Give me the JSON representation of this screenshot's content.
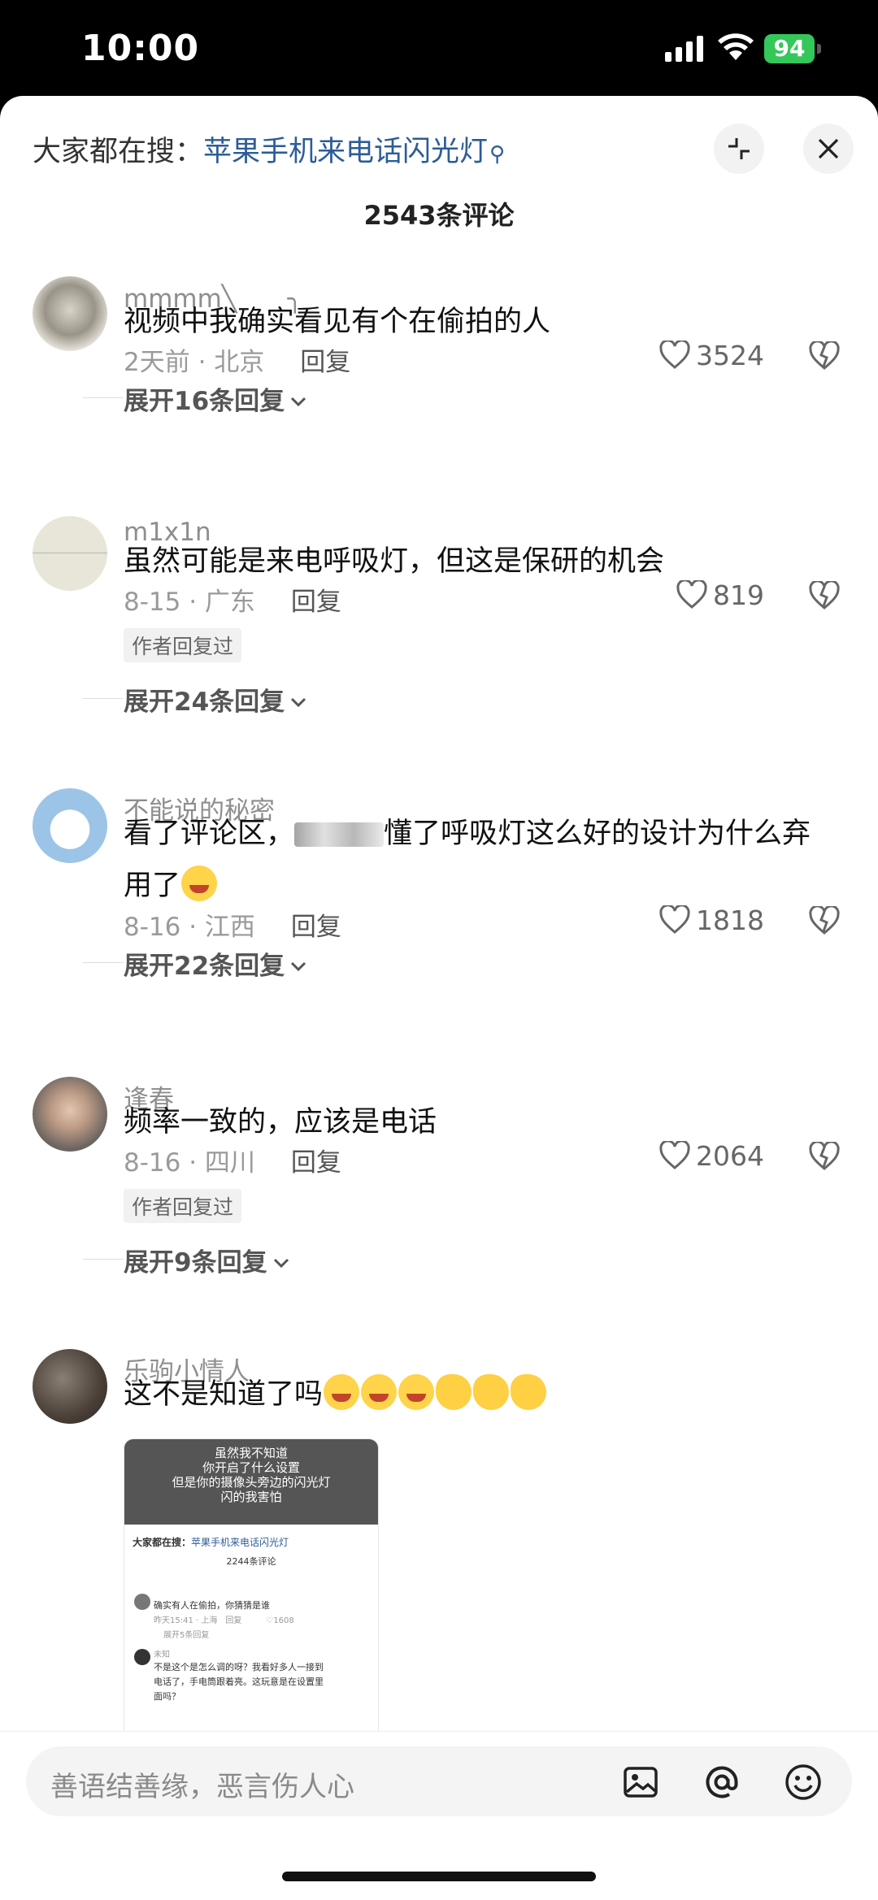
{
  "status_bar": {
    "time": "10:00",
    "battery": "94"
  },
  "header": {
    "search_prefix": "大家都在搜：",
    "search_term": "苹果手机来电话闪光灯",
    "comment_count": "2543条评论"
  },
  "comments": [
    {
      "username": "mmmm╲　　╮",
      "text": "视频中我确实看见有个在偷拍的人",
      "time_location": "2天前 · 北京",
      "reply_label": "回复",
      "likes": "3524",
      "expand": "展开16条回复"
    },
    {
      "username": "m1x1n",
      "text": "虽然可能是来电呼吸灯，但这是保研的机会",
      "time_location": "8-15 · 广东",
      "reply_label": "回复",
      "likes": "819",
      "tag": "作者回复过",
      "expand": "展开24条回复"
    },
    {
      "username": "不能说的秘密",
      "text_a": "看了评论区，",
      "text_b": "懂了呼吸灯这么好的设计为什么弃用了",
      "time_location": "8-16 · 江西",
      "reply_label": "回复",
      "likes": "1818",
      "expand": "展开22条回复"
    },
    {
      "username": "逢春",
      "text": "频率一致的，应该是电话",
      "time_location": "8-16 · 四川",
      "reply_label": "回复",
      "likes": "2064",
      "tag": "作者回复过",
      "expand": "展开9条回复"
    },
    {
      "username": "乐驹小情人",
      "text": "这不是知道了吗",
      "emojis": [
        "crying-laughing",
        "crying-laughing",
        "crying-laughing",
        "ok-hand",
        "ok-hand",
        "ok-hand"
      ]
    }
  ],
  "thumbnail": {
    "top_lines": [
      "虽然我不知道",
      "你开启了什么设置",
      "但是你的摄像头旁边的闪光灯",
      "闪的我害怕"
    ],
    "search_prefix": "大家都在搜：",
    "search_term": "苹果手机来电话闪光灯",
    "count": "2244条评论",
    "c1_text": "确实有人在偷拍，你猜猜是谁",
    "c1_meta": "昨天15:41 · 上海　回复　　　♡1608",
    "c1_expand": "展开5条回复",
    "c2_user": "未知",
    "c2_l1": "不是这个是怎么调的呀？我看好多人一接到",
    "c2_l2": "电话了，手电筒跟着亮。这玩意是在设置里",
    "c2_l3": "面吗？"
  },
  "composer": {
    "placeholder": "善语结善缘，恶言伤人心"
  }
}
